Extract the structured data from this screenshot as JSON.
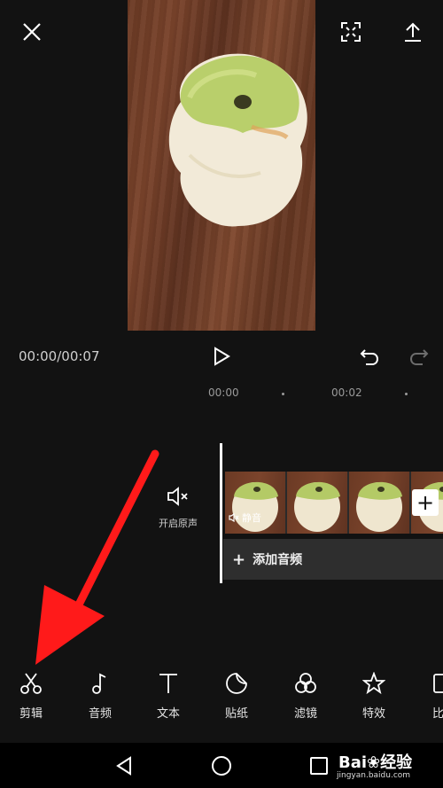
{
  "player": {
    "close_icon": "close-icon",
    "fullscreen_icon": "fullscreen-icon",
    "export_icon": "export-icon",
    "time_display": "00:00/00:07",
    "play_icon": "play-icon",
    "undo_icon": "undo-icon",
    "redo_icon": "redo-icon"
  },
  "timeline": {
    "ruler_marks": [
      "00:00",
      "00:02"
    ],
    "original_sound_label": "开启原声",
    "mute_tag_label": "静音",
    "add_clip_label": "+",
    "add_audio_label": "添加音频",
    "add_audio_plus": "+"
  },
  "toolbar": {
    "items": [
      {
        "label": "剪辑",
        "icon": "scissors-icon"
      },
      {
        "label": "音频",
        "icon": "music-note-icon"
      },
      {
        "label": "文本",
        "icon": "text-icon"
      },
      {
        "label": "贴纸",
        "icon": "sticker-icon"
      },
      {
        "label": "滤镜",
        "icon": "filter-icon"
      },
      {
        "label": "特效",
        "icon": "effects-star-icon"
      },
      {
        "label": "比",
        "icon": "ratio-icon"
      }
    ]
  },
  "annotation": {
    "arrow_color": "#ff1a1a"
  },
  "watermark": {
    "brand": "Bai",
    "brand2": "经验",
    "url": "jingyan.baidu.com"
  },
  "colors": {
    "background": "#121212",
    "accent": "#ffffff"
  }
}
